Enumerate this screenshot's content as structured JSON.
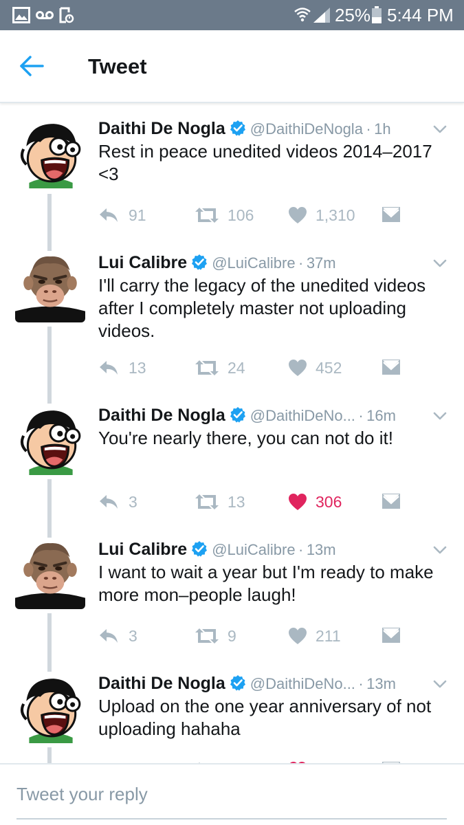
{
  "status_bar": {
    "battery": "25%",
    "time": "5:44 PM",
    "icons": [
      "gallery-icon",
      "voicemail-icon",
      "screenshot-icon",
      "wifi-icon",
      "signal-icon",
      "battery-icon"
    ]
  },
  "header": {
    "title": "Tweet"
  },
  "tweets": [
    {
      "name": "Daithi De Nogla",
      "handle": "@DaithiDeNogla",
      "dot": "·",
      "time": "1h",
      "text": "Rest in peace unedited videos 2014–2017 <3",
      "replies": "91",
      "retweets": "106",
      "likes": "1,310"
    },
    {
      "name": "Lui Calibre",
      "handle": "@LuiCalibre",
      "dot": "·",
      "time": "37m",
      "text": "I'll carry the legacy of the unedited videos after I completely master not uploading videos.",
      "replies": "13",
      "retweets": "24",
      "likes": "452"
    },
    {
      "name": "Daithi De Nogla",
      "handle": "@DaithiDeNo...",
      "dot": "·",
      "time": "16m",
      "text": "You're nearly there, you can not do it!",
      "replies": "3",
      "retweets": "13",
      "likes": "306",
      "liked": true
    },
    {
      "name": "Lui Calibre",
      "handle": "@LuiCalibre",
      "dot": "·",
      "time": "13m",
      "text": "I want to wait a year but I'm ready to make more mon–people laugh!",
      "replies": "3",
      "retweets": "9",
      "likes": "211"
    },
    {
      "name": "Daithi De Nogla",
      "handle": "@DaithiDeNo...",
      "dot": "·",
      "time": "13m",
      "text": "Upload on the one year anniversary of not uploading hahaha"
    }
  ],
  "reply": {
    "placeholder": "Tweet your reply"
  },
  "colors": {
    "accent": "#1da1f2",
    "like_active": "#e0245e",
    "muted": "#8899a6",
    "status_bar": "#6b7a8a"
  }
}
